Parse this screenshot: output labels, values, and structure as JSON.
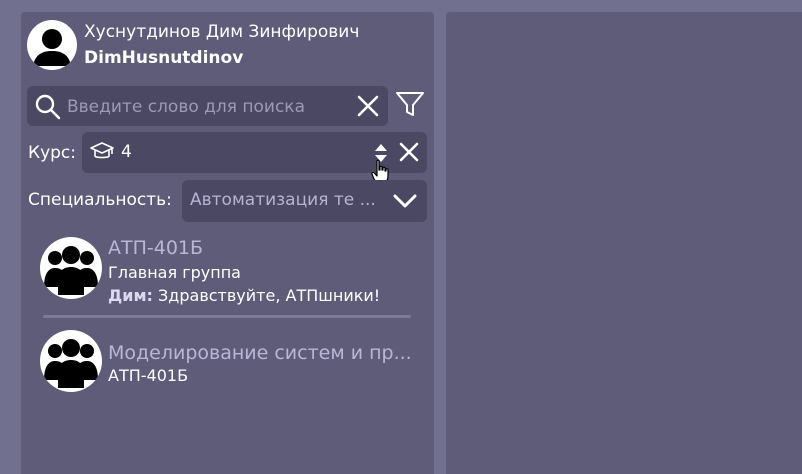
{
  "profile": {
    "name": "Хуснутдинов Дим Зинфирович",
    "login": "DimHusnutdinov"
  },
  "search": {
    "placeholder": "Введите слово для поиска",
    "value": ""
  },
  "filters": {
    "course_label": "Курс:",
    "course_value": "4",
    "specialty_label": "Специальность:",
    "specialty_value": "Автоматизация те ..."
  },
  "chats": [
    {
      "title": "АТП-401Б",
      "subtitle": "Главная группа",
      "last_author": "Дим:",
      "last_message": "Здравствуйте, АТПшники!"
    },
    {
      "title": "Моделирование систем и пр...",
      "subtitle": "АТП-401Б"
    }
  ],
  "icons": {
    "profile": "user-avatar-icon",
    "search": "search-icon",
    "clear": "close-icon",
    "filter": "filter-icon",
    "course": "graduation-cap-icon",
    "spinner": "spinner-arrows-icon",
    "dropdown": "chevron-down-icon",
    "group": "group-avatar-icon",
    "cursor": "hand-cursor-icon"
  },
  "colors": {
    "background": "#72708f",
    "panel": "#5e5c79",
    "input": "#4a4862",
    "accent_text": "#b9b7d6"
  }
}
